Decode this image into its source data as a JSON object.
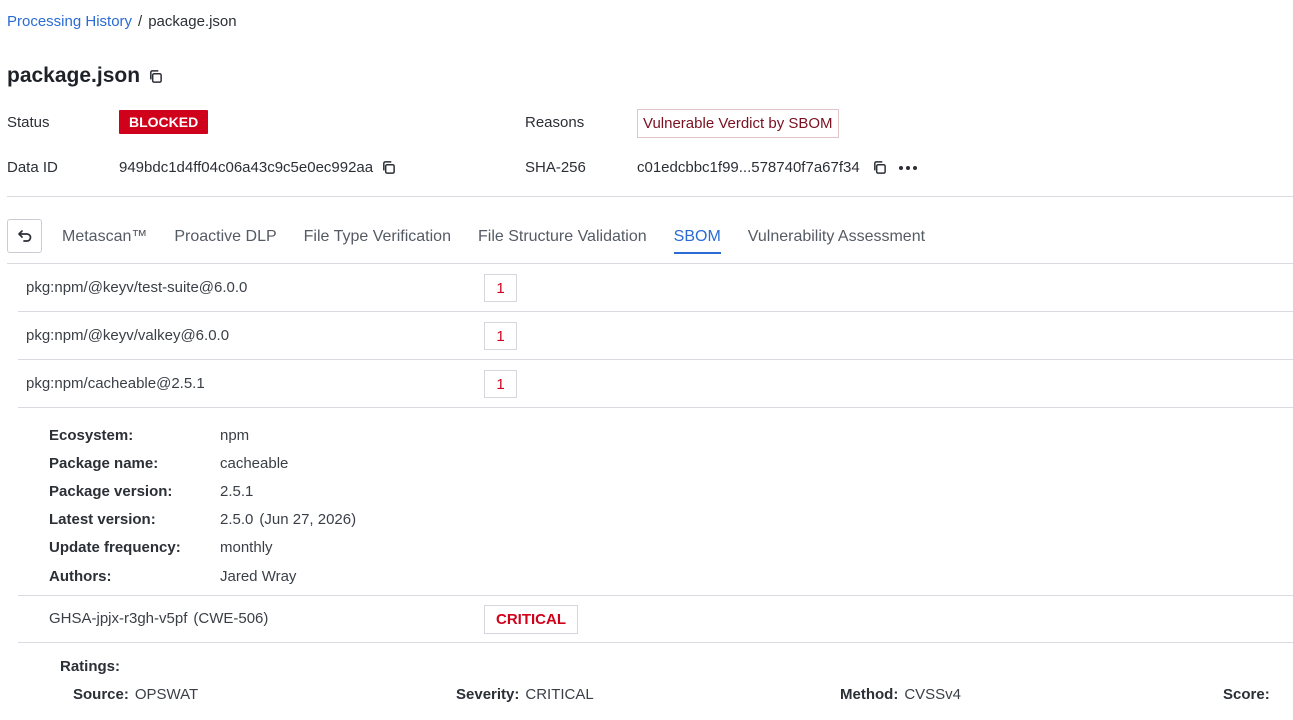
{
  "breadcrumb": {
    "parent": "Processing History",
    "separator": "/",
    "current": "package.json"
  },
  "file": {
    "title": "package.json"
  },
  "meta": {
    "status_label": "Status",
    "status_value": "BLOCKED",
    "reasons_label": "Reasons",
    "reasons_value": "Vulnerable Verdict by SBOM",
    "dataid_label": "Data ID",
    "dataid_value": "949bdc1d4ff04c06a43c9c5e0ec992aa",
    "sha_label": "SHA-256",
    "sha_value": "c01edcbbc1f99...578740f7a67f34"
  },
  "tabs": [
    {
      "label": "Metascan™",
      "active": false
    },
    {
      "label": "Proactive DLP",
      "active": false
    },
    {
      "label": "File Type Verification",
      "active": false
    },
    {
      "label": "File Structure Validation",
      "active": false
    },
    {
      "label": "SBOM",
      "active": true
    },
    {
      "label": "Vulnerability Assessment",
      "active": false
    }
  ],
  "packages": [
    {
      "name": "pkg:npm/@keyv/test-suite@6.0.0",
      "count": "1"
    },
    {
      "name": "pkg:npm/@keyv/valkey@6.0.0",
      "count": "1"
    },
    {
      "name": "pkg:npm/cacheable@2.5.1",
      "count": "1"
    }
  ],
  "details": {
    "ecosystem_label": "Ecosystem:",
    "ecosystem_value": "npm",
    "package_name_label": "Package name:",
    "package_name_value": "cacheable",
    "package_version_label": "Package version:",
    "package_version_value": "2.5.1",
    "latest_version_label": "Latest version:",
    "latest_version_value": "2.5.0",
    "latest_version_date": "(Jun 27, 2026)",
    "update_frequency_label": "Update frequency:",
    "update_frequency_value": "monthly",
    "authors_label": "Authors:",
    "authors_value": "Jared Wray"
  },
  "vulnerability": {
    "id": "GHSA-jpjx-r3gh-v5pf",
    "cwe": "(CWE-506)",
    "severity": "CRITICAL"
  },
  "ratings": {
    "title": "Ratings:",
    "source_label": "Source:",
    "source_value": "OPSWAT",
    "severity_label": "Severity:",
    "severity_value": "CRITICAL",
    "method_label": "Method:",
    "method_value": "CVSSv4",
    "score_label": "Score:"
  },
  "colors": {
    "accent": "#2a6bd4",
    "danger": "#d0021b"
  }
}
